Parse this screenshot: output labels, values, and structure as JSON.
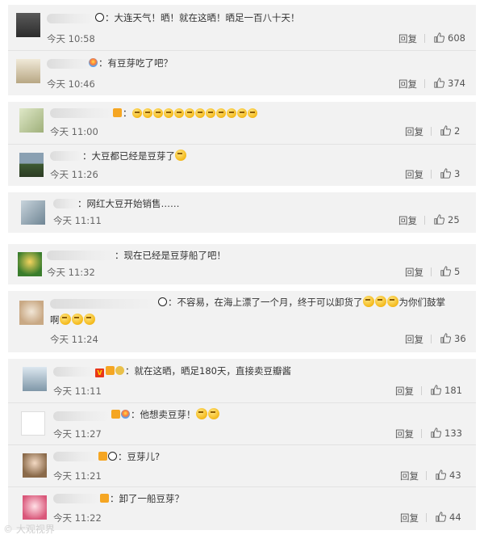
{
  "ui": {
    "reply_label": "回复"
  },
  "comments": [
    {
      "text": "：大连天气！晒！就在这晒！晒足一百八十天！",
      "time": "今天 10:58",
      "likes": "608"
    },
    {
      "text": "：有豆芽吃了吧？",
      "time": "今天 10:46",
      "likes": "374"
    },
    {
      "text": "：",
      "time": "今天 11:00",
      "likes": "2"
    },
    {
      "text": "：大豆都已经是豆芽了",
      "time": "今天 11:26",
      "likes": "3"
    },
    {
      "text": "：网红大豆开始销售……",
      "time": "今天 11:11",
      "likes": "25"
    },
    {
      "text": "：现在已经是豆芽船了吧！",
      "time": "今天 11:32",
      "likes": "5"
    },
    {
      "text": "：不容易，在海上漂了一个月，终于可以卸货了",
      "text_b": "为你们鼓掌",
      "text2": "啊",
      "time": "今天 11:24",
      "likes": "36"
    },
    {
      "text": "：就在这晒，晒足180天，直接卖豆瓣酱",
      "time": "今天 11:11",
      "likes": "181"
    },
    {
      "text": "：他想卖豆芽！",
      "time": "今天 11:27",
      "likes": "133"
    },
    {
      "text": "：豆芽儿?",
      "time": "今天 11:21",
      "likes": "43"
    },
    {
      "text": "：卸了一船豆芽？",
      "time": "今天 11:22",
      "likes": "44"
    }
  ],
  "watermark": "©  大观视界",
  "colors": {
    "card_bg": "#f2f2f2",
    "text": "#333333",
    "muted": "#666666",
    "emoji": "#f4b91a"
  }
}
